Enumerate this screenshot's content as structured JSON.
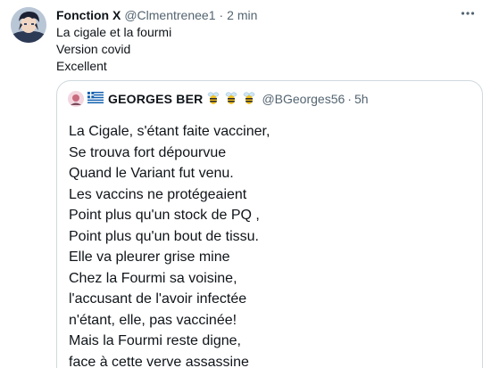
{
  "tweet": {
    "display_name": "Fonction X",
    "handle": "@Clmentrenee1",
    "separator": "·",
    "time": "2 min",
    "more_icon": "more-horizontal-icon",
    "text_lines": [
      "La cigale et la fourmi",
      "Version covid",
      "Excellent"
    ]
  },
  "quoted_tweet": {
    "display_name": "GEORGES BER",
    "name_emojis": [
      "bee-icon",
      "bee-icon",
      "bee-icon"
    ],
    "handle": "@BGeorges56",
    "separator": "·",
    "time": "5h",
    "poem_lines": [
      "La Cigale, s'étant faite vacciner,",
      "Se trouva fort dépourvue",
      "Quand le Variant fut venu.",
      "Les vaccins ne protégeaient",
      "Point plus qu'un stock de PQ ,",
      "Point plus qu'un bout de tissu.",
      "Elle va pleurer grise mine",
      "Chez la Fourmi sa voisine,",
      "l'accusant de l'avoir infectée",
      "n'étant, elle, pas vaccinée!",
      "Mais la Fourmi reste digne,",
      "face à cette verve assassine"
    ]
  },
  "colors": {
    "text_primary": "#0f1419",
    "text_secondary": "#536471",
    "border": "#cfd9de"
  }
}
